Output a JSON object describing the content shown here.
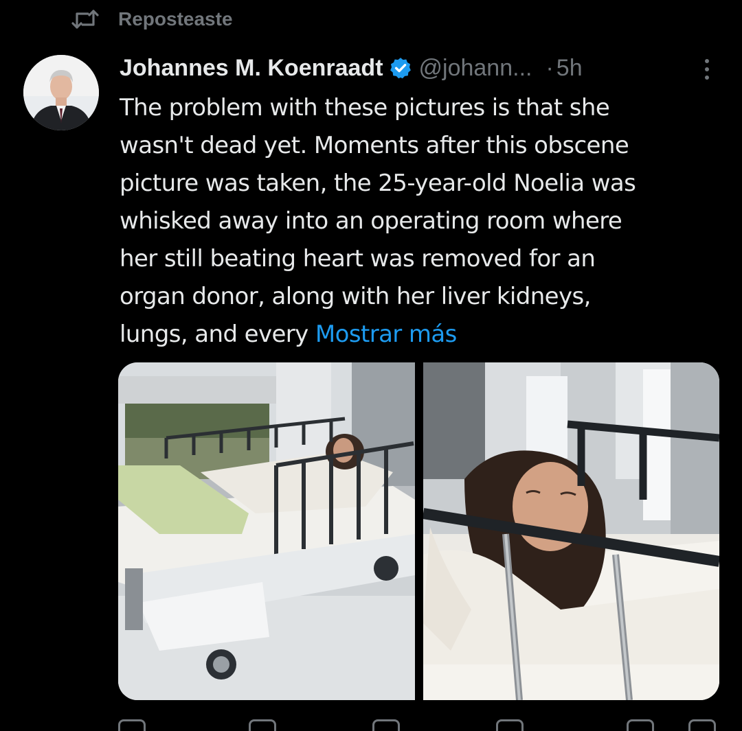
{
  "repost": {
    "label": "Reposteaste",
    "icon": "repost-icon"
  },
  "tweet": {
    "author_name": "Johannes M. Koenraadt",
    "verified_icon": "verified-badge-icon",
    "handle": "@johann...",
    "dot": "·",
    "time": "5h",
    "more_icon": "more-options-icon",
    "text_lines": [
      "The problem with these pictures is that she",
      "wasn't dead yet. Moments after this obscene",
      "picture was taken, the 25-year-old Noelia was",
      "whisked away into an operating room where",
      "her still beating heart was removed for an",
      "organ donor, along with her liver kidneys,",
      "lungs, and every"
    ],
    "show_more": "Mostrar más"
  },
  "colors": {
    "background": "#000000",
    "text": "#e7e9ea",
    "muted": "#71767b",
    "link": "#1d9bf0",
    "verified": "#1d9bf0"
  },
  "actions": [
    {
      "icon": "reply-icon"
    },
    {
      "icon": "repost-action-icon"
    },
    {
      "icon": "like-icon"
    },
    {
      "icon": "views-icon"
    },
    {
      "icon": "bookmark-icon"
    },
    {
      "icon": "share-icon"
    }
  ]
}
